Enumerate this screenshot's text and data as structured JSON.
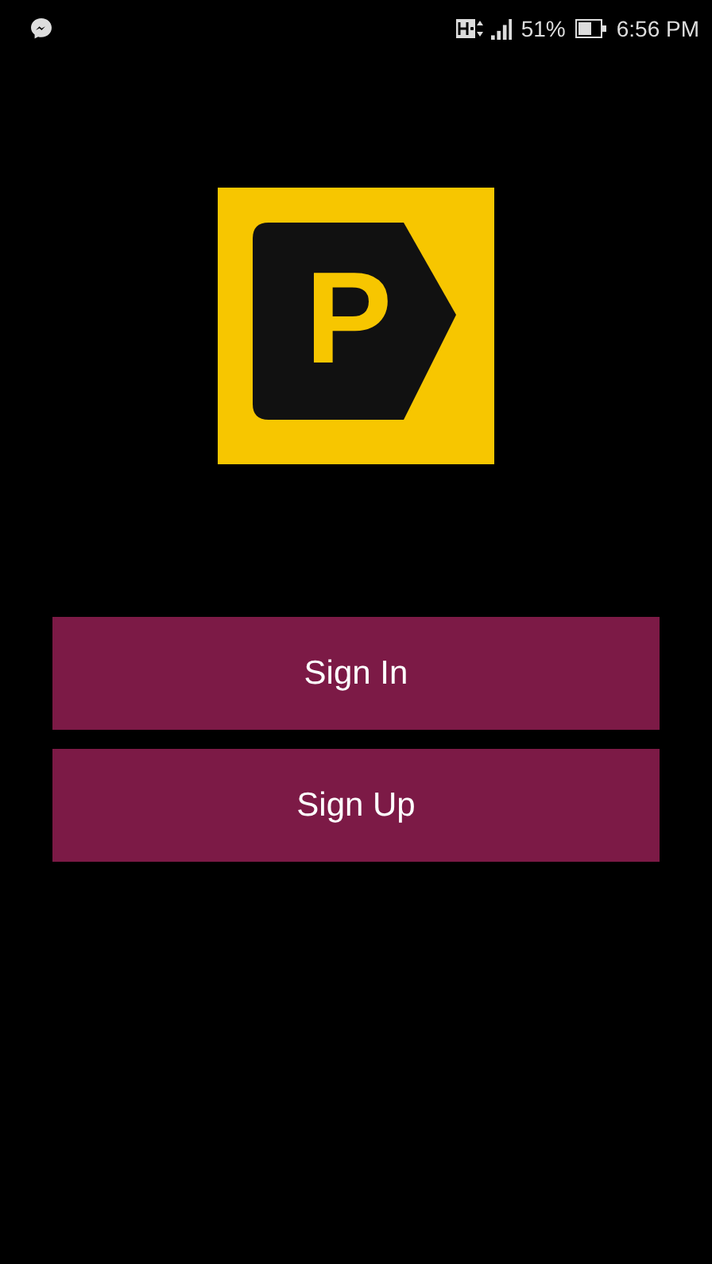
{
  "status_bar": {
    "battery": "51%",
    "time": "6:56 PM"
  },
  "logo": {
    "letter": "P"
  },
  "buttons": [
    {
      "label": "Sign In"
    },
    {
      "label": "Sign Up"
    }
  ]
}
